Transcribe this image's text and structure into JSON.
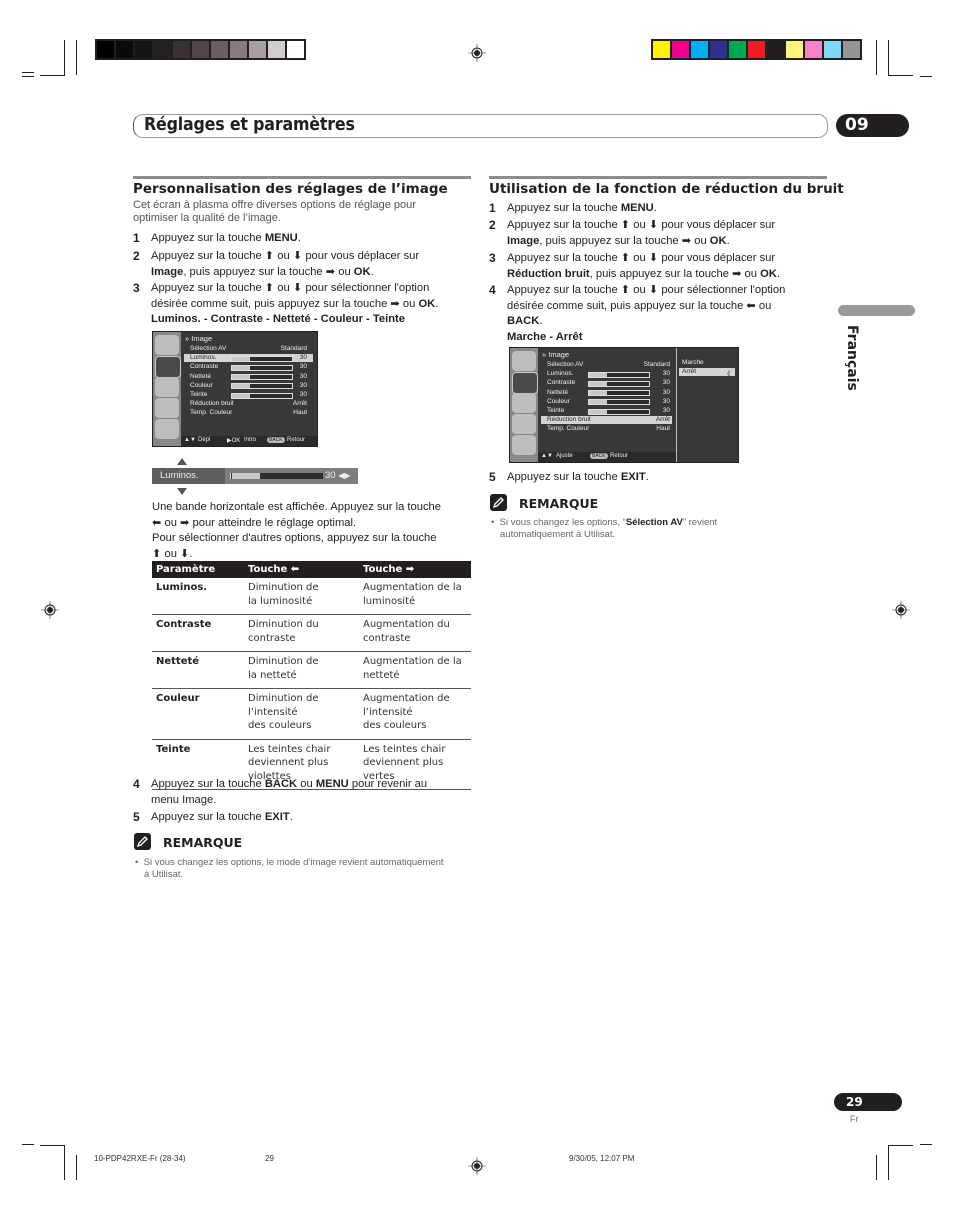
{
  "print_marks": {
    "grayscale_swatches": [
      "#000000",
      "#0c0a09",
      "#181413",
      "#25201e",
      "#3a3230",
      "#504644",
      "#6b5f5d",
      "#877c7b",
      "#a7a09e",
      "#d4cccb",
      "#ffffff"
    ],
    "color_swatches": [
      "#fff200",
      "#ec008c",
      "#00aeef",
      "#2e3192",
      "#00a651",
      "#ed1c24",
      "#231f20",
      "#fff57c",
      "#f384c4",
      "#7dd8f7",
      "#939598"
    ]
  },
  "header": {
    "title": "Réglages et paramètres",
    "chapter": "09"
  },
  "sidebar": {
    "language": "Français"
  },
  "left": {
    "title": "Personnalisation des réglages de l’image",
    "intro": "Cet écran à plasma offre diverses options de réglage pour optimiser la qualité de l’image.",
    "steps": [
      {
        "num": "1",
        "pre": "Appuyez sur la touche ",
        "bold": "MENU",
        "post": "."
      },
      {
        "num": "2",
        "line1": "Appuyez sur la touche ⬆ ou ⬇ pour vous déplacer sur",
        "bold": "Image",
        "post": ", puis appuyez sur la touche ➡ ou ",
        "bold2": "OK",
        "end": "."
      },
      {
        "num": "3",
        "line1": "Appuyez sur la touche ⬆ ou ⬇ pour sélectionner l'option",
        "line2pre": "désirée comme suit, puis appuyez sur la touche ➡ ou ",
        "bold": "OK",
        "end": ".",
        "options": "Luminos. - Contraste - Netteté - Couleur - Teinte"
      },
      {
        "num": "4",
        "pre": "Appuyez sur la touche ",
        "bold": "BACK",
        "mid": " ou ",
        "bold2": "MENU",
        "post": " pour revenir au",
        "line2": "menu Image."
      },
      {
        "num": "5",
        "pre": "Appuyez sur la touche ",
        "bold": "EXIT",
        "post": "."
      }
    ],
    "osd": {
      "title": "Image",
      "rows": [
        {
          "label": "Sélection AV",
          "value": "Standard"
        },
        {
          "label": "Luminos.",
          "value": "30",
          "slider": 0.3,
          "selected": true
        },
        {
          "label": "Contraste",
          "value": "30",
          "slider": 0.3
        },
        {
          "label": "Netteté",
          "value": "30",
          "slider": 0.3
        },
        {
          "label": "Couleur",
          "value": "30",
          "slider": 0.3
        },
        {
          "label": "Teinte",
          "value": "30",
          "slider": 0.3
        },
        {
          "label": "Réduction bruit",
          "value": "Arrêt"
        },
        {
          "label": "Temp. Couleur",
          "value": "Haut"
        }
      ],
      "footer": {
        "nav": "Dépl",
        "enter": "Intro",
        "back_key": "BACK",
        "back": "Retour"
      }
    },
    "band": {
      "label": "Luminos.",
      "value": "30",
      "level": 0.3
    },
    "band_text": [
      "Une bande horizontale est affichée. Appuyez sur la touche",
      "⬅ ou ➡ pour atteindre le réglage optimal.",
      "Pour sélectionner d'autres options, appuyez sur la touche",
      "⬆ ou ⬇."
    ],
    "table": {
      "headers": [
        "Paramètre",
        "Touche ⬅",
        "Touche ➡"
      ],
      "rows": [
        {
          "param": "Luminos.",
          "left": "Diminution de\nla luminosité",
          "right": "Augmentation de la\nluminosité"
        },
        {
          "param": "Contraste",
          "left": "Diminution du\ncontraste",
          "right": "Augmentation du\ncontraste"
        },
        {
          "param": "Netteté",
          "left": "Diminution de\nla netteté",
          "right": "Augmentation de la\nnetteté"
        },
        {
          "param": "Couleur",
          "left": "Diminution de\nl’intensité\ndes couleurs",
          "right": "Augmentation de\nl’intensité\ndes couleurs"
        },
        {
          "param": "Teinte",
          "left": "Les teintes chair\ndeviennent plus\nviolettes",
          "right": "Les teintes chair\ndeviennent plus\nvertes"
        }
      ]
    },
    "remark": {
      "title": "REMARQUE",
      "line1": "Si vous changez les options, le mode d’image revient automatiquement",
      "line2": "à Utilisat."
    }
  },
  "right": {
    "title": "Utilisation de la fonction de réduction du bruit",
    "steps": [
      {
        "num": "1",
        "pre": "Appuyez sur la touche ",
        "bold": "MENU",
        "post": "."
      },
      {
        "num": "2",
        "line1": "Appuyez sur la touche ⬆ ou ⬇ pour vous déplacer sur",
        "bold": "Image",
        "post": ", puis appuyez sur la touche ➡ ou ",
        "bold2": "OK",
        "end": "."
      },
      {
        "num": "3",
        "line1": "Appuyez sur la touche ⬆ ou ⬇ pour vous déplacer sur",
        "bold": "Réduction bruit",
        "post": ", puis appuyez sur la touche ➡ ou ",
        "bold2": "OK",
        "end": "."
      },
      {
        "num": "4",
        "line1": "Appuyez sur la touche ⬆ ou ⬇ pour sélectionner l'option",
        "line2": "désirée comme suit, puis appuyez sur la touche ⬅ ou",
        "bold": "BACK",
        "end": ".",
        "options": "Marche - Arrêt"
      },
      {
        "num": "5",
        "pre": "Appuyez sur la touche ",
        "bold": "EXIT",
        "post": "."
      }
    ],
    "osd": {
      "title": "Image",
      "rows": [
        {
          "label": "Sélection AV",
          "value": "Standard"
        },
        {
          "label": "Luminos.",
          "value": "30",
          "slider": 0.3
        },
        {
          "label": "Contraste",
          "value": "30",
          "slider": 0.3
        },
        {
          "label": "Netteté",
          "value": "30",
          "slider": 0.3
        },
        {
          "label": "Couleur",
          "value": "30",
          "slider": 0.3
        },
        {
          "label": "Teinte",
          "value": "30",
          "slider": 0.3
        },
        {
          "label": "Réduction bruit",
          "value": "Arrêt",
          "selected": true
        },
        {
          "label": "Temp. Couleur",
          "value": "Haut"
        }
      ],
      "submenu": [
        {
          "label": "Marche"
        },
        {
          "label": "Arrêt",
          "selected": true,
          "marker": "《"
        }
      ],
      "footer": {
        "nav": "Ajuste",
        "back_key": "BACK",
        "back": "Retour"
      }
    },
    "remark": {
      "title": "REMARQUE",
      "pre": "Si vous changez les options, “",
      "bold": "Sélection AV",
      "post": "” revient",
      "line2": "automatiquement à Utilisat."
    }
  },
  "page": {
    "number": "29",
    "lang": "Fr"
  },
  "footer": {
    "file": "10-PDP42RXE-Fr (28-34)",
    "page": "29",
    "date": "9/30/05, 12:07 PM"
  }
}
